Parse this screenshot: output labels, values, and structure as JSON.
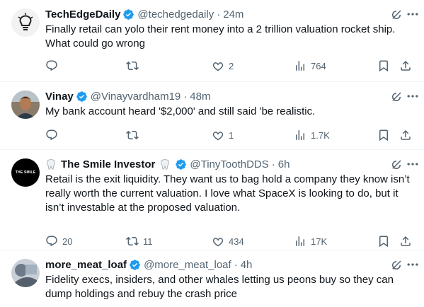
{
  "tweets": [
    {
      "name": "TechEdgeDaily",
      "handle": "@techedgedaily",
      "time": "24m",
      "text": "Finally retail can yolo their rent money into a 2 trillion valuation rocket ship. What could go wrong",
      "replies": "",
      "retweets": "",
      "likes": "2",
      "views": "764"
    },
    {
      "name": "Vinay",
      "handle": "@Vinayvardham19",
      "time": "48m",
      "text": "My bank account heard '$2,000' and still said 'be realistic.",
      "replies": "",
      "retweets": "",
      "likes": "1",
      "views": "1.7K"
    },
    {
      "name": "The Smile Investor",
      "handle": "@TinyToothDDS",
      "time": "6h",
      "avatar_text": "THE SMILE",
      "text": "Retail is the exit liquidity. They want us to bag hold a company they know isn’t really worth the current valuation. I love what SpaceX is looking to do, but it isn’t investable at the proposed valuation.",
      "replies": "20",
      "retweets": "11",
      "likes": "434",
      "views": "17K"
    },
    {
      "name": "more_meat_loaf",
      "handle": "@more_meat_loaf",
      "time": "4h",
      "text": "Fidelity execs, insiders, and other whales letting us peons buy so they can dump holdings and rebuy the crash price"
    }
  ],
  "separator": "·",
  "colors": {
    "verified": "#1d9bf0",
    "muted": "#536471",
    "text": "#0f1419",
    "divider": "#eff3f4"
  }
}
